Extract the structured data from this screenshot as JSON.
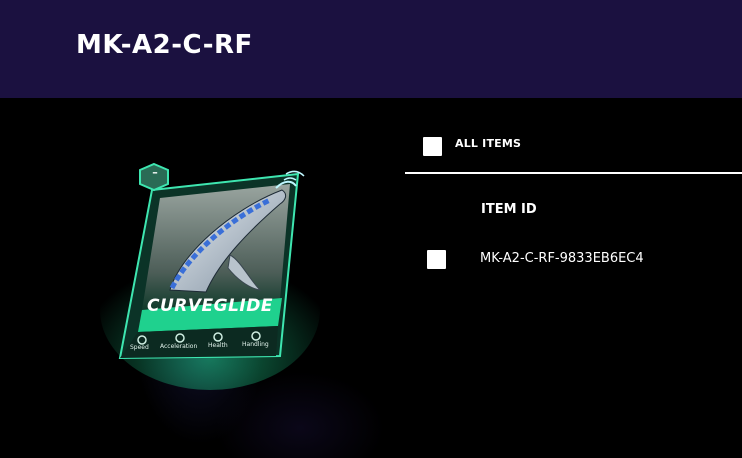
{
  "header": {
    "title": "MK-A2-C-RF"
  },
  "card": {
    "name": "CURVEGLIDE",
    "badge": "–",
    "stats": [
      "Speed",
      "Acceleration",
      "Health",
      "Handling"
    ],
    "colors": {
      "frame": "#3ee6b0",
      "glow": "#1fd18e",
      "badge": "#2a6b55"
    }
  },
  "list": {
    "select_all_label": "ALL ITEMS",
    "column_header": "ITEM ID",
    "rows": [
      {
        "id": "MK-A2-C-RF-9833EB6EC4"
      }
    ]
  }
}
